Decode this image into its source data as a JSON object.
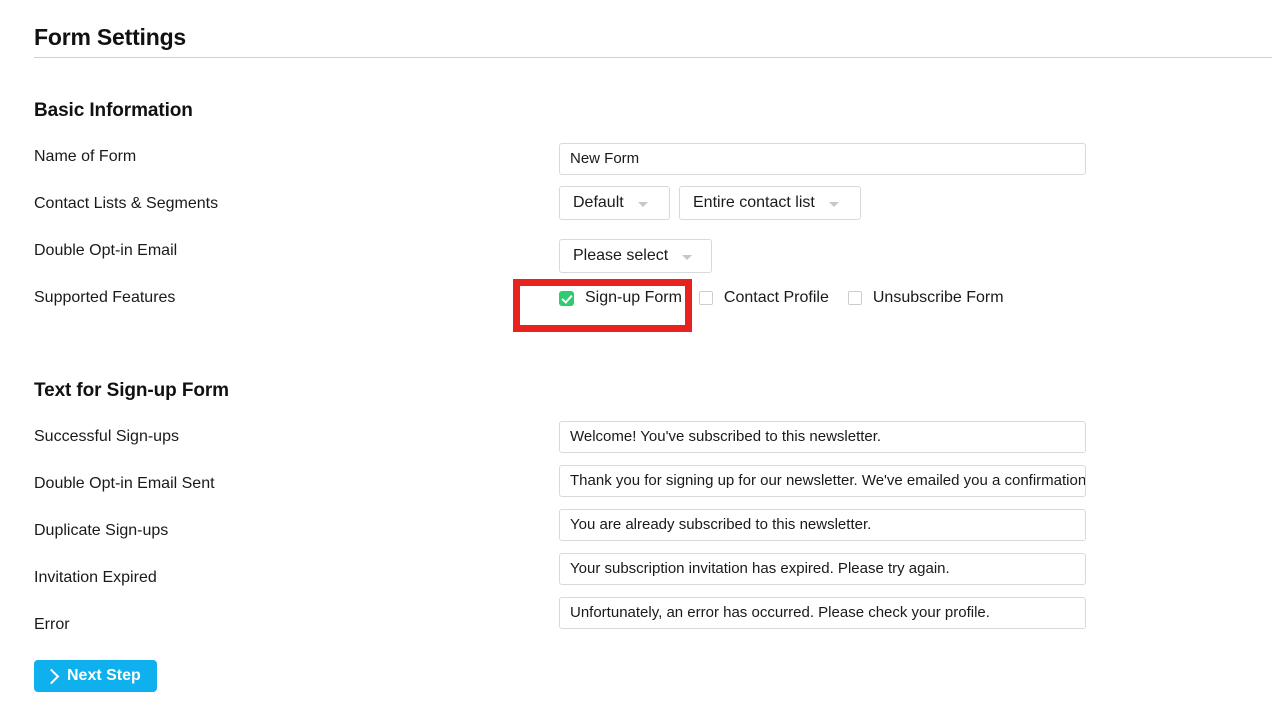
{
  "page": {
    "title": "Form Settings"
  },
  "sections": {
    "basic": {
      "heading": "Basic Information",
      "fields": {
        "name_of_form": {
          "label": "Name of Form",
          "value": "New Form"
        },
        "contact_lists": {
          "label": "Contact Lists & Segments",
          "list_select": "Default",
          "segment_select": "Entire contact list"
        },
        "double_optin_email": {
          "label": "Double Opt-in Email",
          "select": "Please select"
        },
        "supported_features": {
          "label": "Supported Features",
          "options": [
            {
              "label": "Sign-up Form",
              "checked": true
            },
            {
              "label": "Contact Profile",
              "checked": false
            },
            {
              "label": "Unsubscribe Form",
              "checked": false
            }
          ]
        }
      }
    },
    "text_signup": {
      "heading": "Text for Sign-up Form",
      "fields": [
        {
          "label": "Successful Sign-ups",
          "value": "Welcome! You've subscribed to this newsletter."
        },
        {
          "label": "Double Opt-in Email Sent",
          "value": "Thank you for signing up for our newsletter. We've emailed you a confirmation link."
        },
        {
          "label": "Duplicate Sign-ups",
          "value": "You are already subscribed to this newsletter."
        },
        {
          "label": "Invitation Expired",
          "value": "Your subscription invitation has expired. Please try again."
        },
        {
          "label": "Error",
          "value": "Unfortunately, an error has occurred. Please check your profile."
        }
      ]
    }
  },
  "footer": {
    "next_step_label": "Next Step"
  },
  "annotation": {
    "highlight_color": "#e8231f",
    "target": "Sign-up Form"
  },
  "colors": {
    "accent_button": "#0fb0ee",
    "checkbox_checked": "#2ecc71",
    "border": "#d6dadd",
    "rule": "#ccd2d6"
  }
}
